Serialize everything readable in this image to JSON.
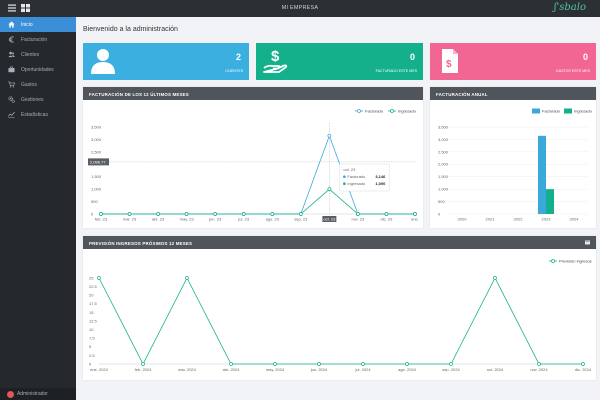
{
  "app": {
    "title": "MI EMPRESA",
    "brand": "ʃ'sbalo"
  },
  "sidebar": {
    "items": [
      {
        "label": "Inicio",
        "icon": "home-icon",
        "active": true
      },
      {
        "label": "Facturación",
        "icon": "euro-icon",
        "active": false
      },
      {
        "label": "Clientes",
        "icon": "users-icon",
        "active": false
      },
      {
        "label": "Oportunidades",
        "icon": "briefcase-icon",
        "active": false
      },
      {
        "label": "Gastos",
        "icon": "cart-icon",
        "active": false
      },
      {
        "label": "Gestiones",
        "icon": "gears-icon",
        "active": false
      },
      {
        "label": "Estadísticas",
        "icon": "stats-icon",
        "active": false
      }
    ],
    "user": "Administrador"
  },
  "main": {
    "title": "Bienvenido a la administración"
  },
  "cards": [
    {
      "value": "2",
      "label": "CLIENTES",
      "color": "#3bb0e0",
      "icon": "user-icon"
    },
    {
      "value": "0",
      "label": "FACTURADO ESTE MES",
      "color": "#14b08c",
      "icon": "money-hand-icon"
    },
    {
      "value": "0",
      "label": "GASTOS ESTE MES",
      "color": "#f26694",
      "icon": "invoice-icon"
    }
  ],
  "colors": {
    "facturado": "#3aa8d8",
    "ingresado": "#14b08c"
  },
  "panels": {
    "monthly": {
      "title": "FACTURACIÓN DE LOS 12 ÚLTIMOS MESES",
      "tooltip": {
        "title": "oct. 23",
        "rows": [
          {
            "name": "Facturado",
            "value": "3,146"
          },
          {
            "name": "Ingresado",
            "value": "1,000"
          }
        ]
      },
      "crosshair_label": "2,096.77"
    },
    "annual": {
      "title": "FACTURACIÓN ANUAL"
    },
    "forecast": {
      "title": "PREVISIÓN INGRESOS PRÓXIMOS 12 MESES"
    }
  },
  "chart_data": [
    {
      "type": "line",
      "title": "FACTURACIÓN DE LOS 12 ÚLTIMOS MESES",
      "x": [
        "feb. 23",
        "mar. 23",
        "abr. 23",
        "may. 23",
        "jun. 23",
        "jul. 23",
        "ago. 23",
        "sep. 23",
        "oct. 23",
        "nov. 23",
        "dic. 23",
        "ene. 24"
      ],
      "x_tick_labels": [
        "feb. 23",
        "mar. 23",
        "abr. 23",
        "may. 23",
        "jun. 23",
        "jul. 23",
        "ago. 23",
        "sep. 23",
        "oct. 23",
        "nov. 23",
        "dic. 23",
        "ene."
      ],
      "series": [
        {
          "name": "Facturado",
          "values": [
            0,
            0,
            0,
            0,
            0,
            0,
            0,
            0,
            3146,
            0,
            0,
            0
          ]
        },
        {
          "name": "Ingresado",
          "values": [
            0,
            0,
            0,
            0,
            0,
            0,
            0,
            0,
            1000,
            0,
            0,
            0
          ]
        }
      ],
      "ylim": [
        0,
        3500
      ],
      "yticks": [
        0,
        500,
        1000,
        1500,
        2000,
        2500,
        3000,
        3500
      ],
      "ytick_labels": [
        "0",
        "500",
        "1,000",
        "1,500",
        "2,000",
        "2,500",
        "3,000",
        "3,500"
      ],
      "highlight_x": "oct. 23",
      "crosshair_y": 2096.77,
      "legend": "top-right",
      "grid": false
    },
    {
      "type": "bar",
      "title": "FACTURACIÓN ANUAL",
      "categories": [
        "2020",
        "2021",
        "2022",
        "2023",
        "2024"
      ],
      "series": [
        {
          "name": "Facturado",
          "values": [
            0,
            0,
            0,
            3146,
            0
          ]
        },
        {
          "name": "Ingresado",
          "values": [
            0,
            0,
            0,
            1000,
            0
          ]
        }
      ],
      "ylim": [
        0,
        3500
      ],
      "yticks": [
        0,
        500,
        1000,
        1500,
        2000,
        2500,
        3000,
        3500
      ],
      "ytick_labels": [
        "0",
        "500",
        "1,000",
        "1,500",
        "2,000",
        "2,500",
        "3,000",
        "3,500"
      ],
      "legend": "top-right",
      "grid": true
    },
    {
      "type": "line",
      "title": "PREVISIÓN INGRESOS PRÓXIMOS 12 MESES",
      "x": [
        "ene. 2024",
        "feb. 2024",
        "mar. 2024",
        "abr. 2024",
        "may. 2024",
        "jun. 2024",
        "jul. 2024",
        "ago. 2024",
        "sep. 2024",
        "oct. 2024",
        "nov. 2024",
        "dic. 2024"
      ],
      "series": [
        {
          "name": "Previsión ingresos",
          "values": [
            25,
            0,
            25,
            0,
            0,
            0,
            0,
            0,
            0,
            25,
            0,
            0
          ]
        }
      ],
      "ylim": [
        0,
        25
      ],
      "yticks": [
        0,
        2.5,
        5,
        7.5,
        10,
        12.5,
        15,
        17.5,
        20,
        22.5,
        25
      ],
      "ytick_labels": [
        "0",
        "2.5",
        "5",
        "7.5",
        "10",
        "12.5",
        "15",
        "17.5",
        "20",
        "22.5",
        "25"
      ],
      "legend": "top-right",
      "grid": false
    }
  ]
}
